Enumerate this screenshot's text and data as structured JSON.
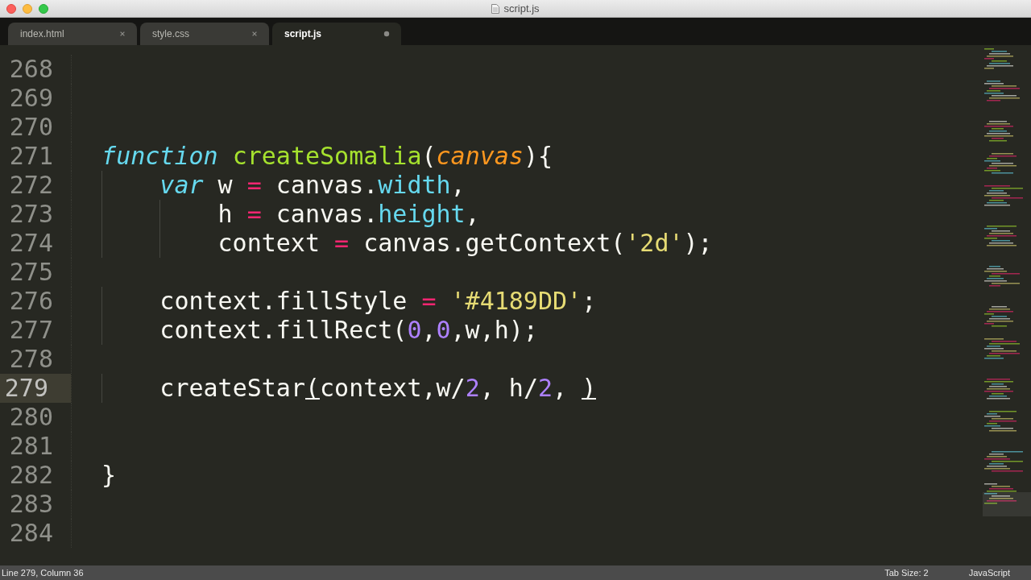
{
  "window": {
    "title": "script.js"
  },
  "tabs": [
    {
      "label": "index.html",
      "selected": false,
      "modified": false
    },
    {
      "label": "style.css",
      "selected": false,
      "modified": false
    },
    {
      "label": "script.js",
      "selected": true,
      "modified": true
    }
  ],
  "editor": {
    "lines": [
      {
        "number": "268",
        "current": false
      },
      {
        "number": "269",
        "current": false
      },
      {
        "number": "270",
        "current": false
      },
      {
        "number": "271",
        "current": false,
        "tokens": [
          {
            "kind": "keyword",
            "text": "  function"
          },
          {
            "kind": "function",
            "text": " createSomalia"
          },
          {
            "kind": "plain",
            "text": "("
          },
          {
            "kind": "param",
            "text": "canvas"
          },
          {
            "kind": "plain",
            "text": "){"
          }
        ]
      },
      {
        "number": "272",
        "current": false,
        "tokens": [
          {
            "kind": "keyword",
            "text": "      var"
          },
          {
            "kind": "plain",
            "text": " w "
          },
          {
            "kind": "operator",
            "text": "="
          },
          {
            "kind": "plain",
            "text": " canvas."
          },
          {
            "kind": "property",
            "text": "width"
          },
          {
            "kind": "plain",
            "text": ","
          }
        ]
      },
      {
        "number": "273",
        "current": false,
        "tokens": [
          {
            "kind": "plain",
            "text": "          h "
          },
          {
            "kind": "operator",
            "text": "="
          },
          {
            "kind": "plain",
            "text": " canvas."
          },
          {
            "kind": "property",
            "text": "height"
          },
          {
            "kind": "plain",
            "text": ","
          }
        ]
      },
      {
        "number": "274",
        "current": false,
        "tokens": [
          {
            "kind": "plain",
            "text": "          context "
          },
          {
            "kind": "operator",
            "text": "="
          },
          {
            "kind": "plain",
            "text": " canvas.getContext("
          },
          {
            "kind": "string",
            "text": "'2d'"
          },
          {
            "kind": "plain",
            "text": ");"
          }
        ]
      },
      {
        "number": "275",
        "current": false
      },
      {
        "number": "276",
        "current": false,
        "tokens": [
          {
            "kind": "plain",
            "text": "      context.fillStyle "
          },
          {
            "kind": "operator",
            "text": "="
          },
          {
            "kind": "string",
            "text": " '#4189DD'"
          },
          {
            "kind": "plain",
            "text": ";"
          }
        ]
      },
      {
        "number": "277",
        "current": false,
        "tokens": [
          {
            "kind": "plain",
            "text": "      context.fillRect("
          },
          {
            "kind": "number",
            "text": "0"
          },
          {
            "kind": "plain",
            "text": ","
          },
          {
            "kind": "number",
            "text": "0"
          },
          {
            "kind": "plain",
            "text": ",w,h);"
          }
        ]
      },
      {
        "number": "278",
        "current": false
      },
      {
        "number": "279",
        "current": true,
        "tokens": [
          {
            "kind": "plain",
            "text": "      createStar"
          },
          {
            "kind": "plain",
            "text": "(",
            "matched": true
          },
          {
            "kind": "plain",
            "text": "context,w/"
          },
          {
            "kind": "number",
            "text": "2"
          },
          {
            "kind": "plain",
            "text": ", h/"
          },
          {
            "kind": "number",
            "text": "2"
          },
          {
            "kind": "plain",
            "text": ", "
          },
          {
            "kind": "plain",
            "text": ")",
            "matched": true
          }
        ]
      },
      {
        "number": "280",
        "current": false
      },
      {
        "number": "281",
        "current": false
      },
      {
        "number": "282",
        "current": false,
        "tokens": [
          {
            "kind": "plain",
            "text": "  }"
          }
        ]
      },
      {
        "number": "283",
        "current": false
      },
      {
        "number": "284",
        "current": false
      }
    ]
  },
  "status_bar": {
    "position": "Line 279, Column 36",
    "tab_size": "Tab Size: 2",
    "syntax": "JavaScript"
  }
}
